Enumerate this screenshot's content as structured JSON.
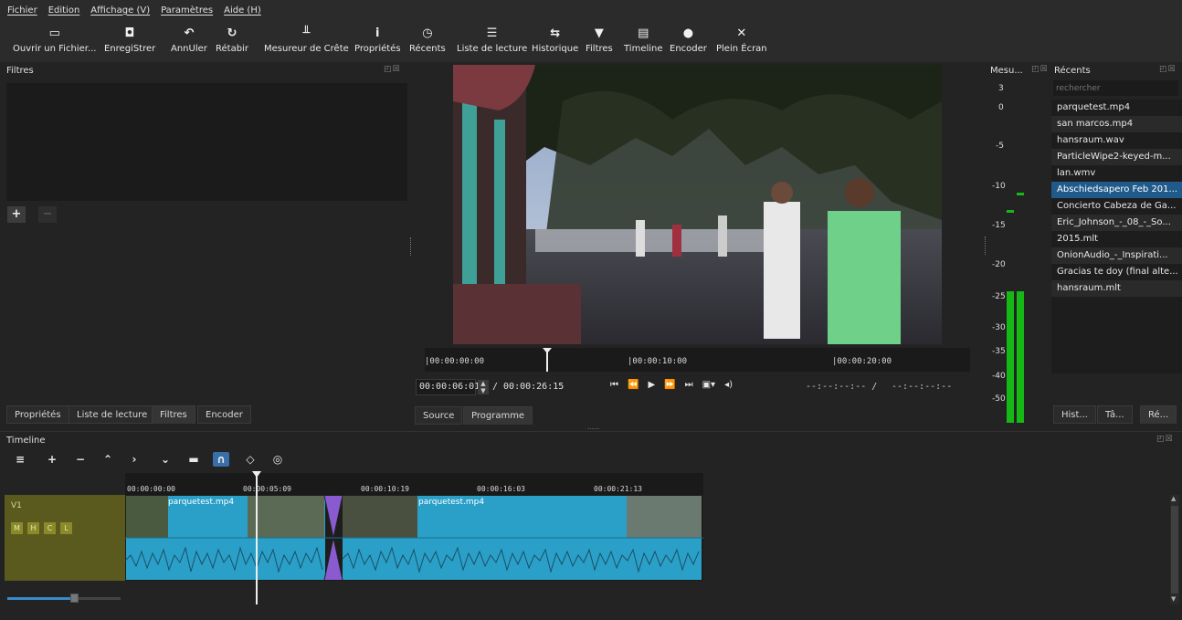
{
  "menu": [
    "Fichier",
    "Edition",
    "Affichage (V)",
    "Paramètres",
    "Aide (H)"
  ],
  "toolbar": [
    {
      "label": "Ouvrir un Fichier...",
      "icon": "folder-icon"
    },
    {
      "label": "EnregiStrer",
      "icon": "save-icon"
    },
    {
      "label": "AnnUler",
      "icon": "undo-icon"
    },
    {
      "label": "Rétabir",
      "icon": "redo-icon"
    },
    {
      "label": "Mesureur de Crête",
      "icon": "peak-meter-icon"
    },
    {
      "label": "Propriétés",
      "icon": "info-icon"
    },
    {
      "label": "Récents",
      "icon": "clock-icon"
    },
    {
      "label": "Liste de lecture",
      "icon": "list-icon"
    },
    {
      "label": "Historique",
      "icon": "history-icon"
    },
    {
      "label": "Filtres",
      "icon": "filter-icon"
    },
    {
      "label": "Timeline",
      "icon": "timeline-icon"
    },
    {
      "label": "Encoder",
      "icon": "encode-icon"
    },
    {
      "label": "Plein Écran",
      "icon": "fullscreen-icon"
    }
  ],
  "filters_panel": {
    "title": "Filtres",
    "tabs": [
      "Propriétés",
      "Liste de lecture",
      "Filtres",
      "Encoder"
    ],
    "active_tab": "Filtres"
  },
  "player": {
    "ruler_labels": [
      "|00:00:00:00",
      "|00:00:10:00",
      "|00:00:20:00"
    ],
    "position": "00:00:06:01",
    "duration": "/ 00:00:26:15",
    "in_point": "--:--:--:-- /",
    "out_point": "--:--:--:--",
    "tabs": [
      "Source",
      "Programme"
    ],
    "active_tab": "Programme",
    "dots": "......"
  },
  "meter": {
    "title": "Mesu...",
    "scale": [
      "3",
      "0",
      "-5",
      "-10",
      "-15",
      "-20",
      "-25",
      "-30",
      "-35",
      "-40",
      "-50"
    ]
  },
  "recents": {
    "title": "Récents",
    "search_placeholder": "rechercher",
    "items": [
      "parquetest.mp4",
      "san marcos.mp4",
      "hansraum.wav",
      "ParticleWipe2-keyed-m...",
      "lan.wmv",
      "Abschiedsapero Feb 201...",
      "Concierto Cabeza de Ga...",
      "Eric_Johnson_-_08_-_So...",
      "2015.mlt",
      "OnionAudio_-_Inspirati...",
      "Gracias te doy (final alte...",
      "hansraum.mlt"
    ],
    "selected_index": 5,
    "tabs": [
      "Hist...",
      "Tâ...",
      "Ré..."
    ]
  },
  "timeline": {
    "title": "Timeline",
    "track_name": "V1",
    "track_buttons": [
      "M",
      "H",
      "C",
      "L"
    ],
    "ruler_labels": [
      "00:00:00:00",
      "00:00:05:09",
      "00:00:10:19",
      "00:00:16:03",
      "00:00:21:13"
    ],
    "clips": [
      {
        "name": "parquetest.mp4"
      },
      {
        "name": "parquetest.mp4"
      }
    ],
    "zoom": 0.6
  },
  "colors": {
    "accent": "#1f5a8a",
    "clip": "#2aa0c8",
    "track_header": "#5a5a1e",
    "transition": "#8a5ad0",
    "meter": "#16b816"
  }
}
